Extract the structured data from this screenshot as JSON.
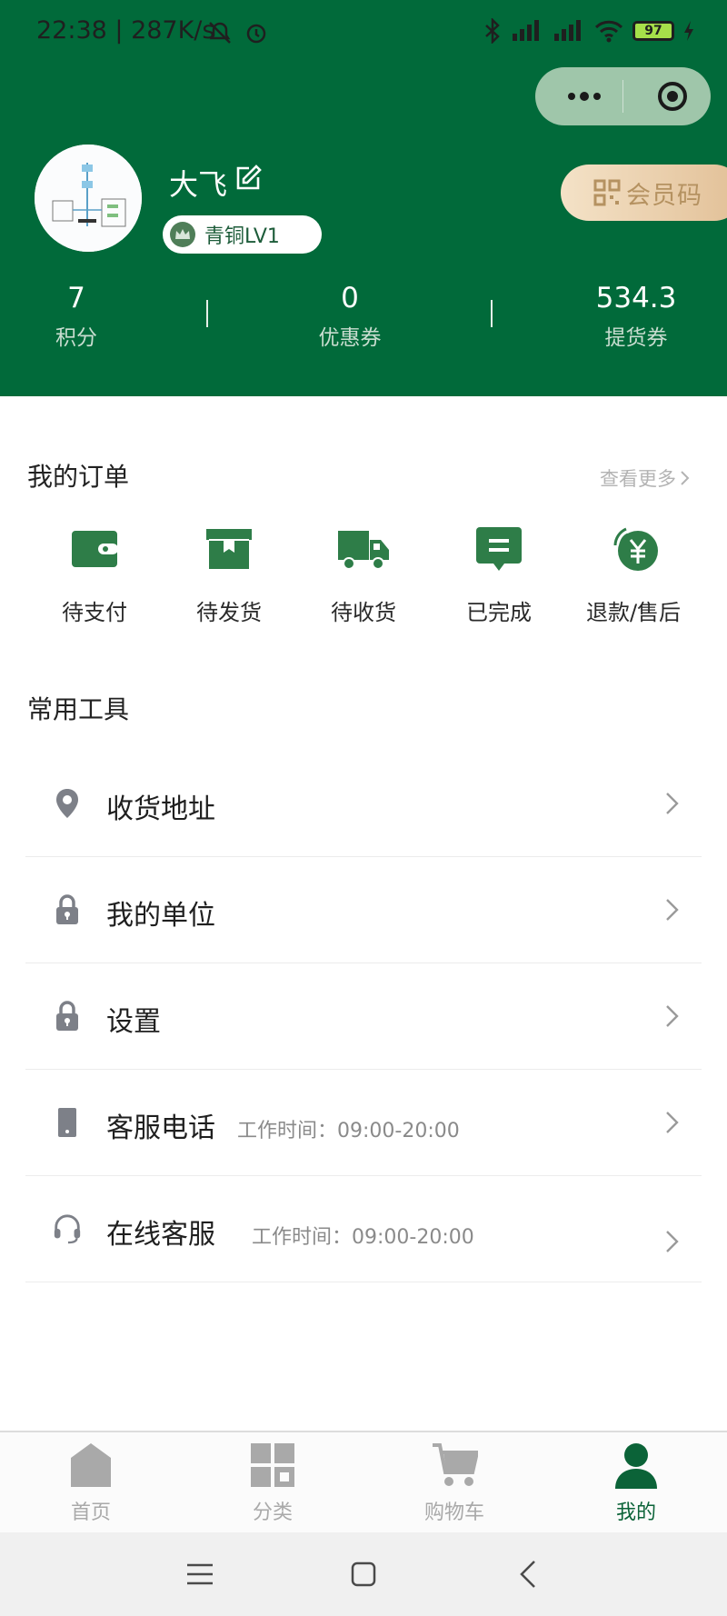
{
  "status_bar": {
    "time_speed": "22:38 | 287K/s",
    "battery": "97"
  },
  "profile": {
    "nickname": "大飞",
    "level": "青铜LV1",
    "member_code_label": "会员码"
  },
  "stats": [
    {
      "value": "7",
      "label": "积分"
    },
    {
      "value": "0",
      "label": "优惠券"
    },
    {
      "value": "534.3",
      "label": "提货券"
    }
  ],
  "orders": {
    "title": "我的订单",
    "see_more": "查看更多",
    "items": [
      {
        "label": "待支付",
        "icon": "wallet-icon"
      },
      {
        "label": "待发货",
        "icon": "box-icon"
      },
      {
        "label": "待收货",
        "icon": "truck-icon"
      },
      {
        "label": "已完成",
        "icon": "message-check-icon"
      },
      {
        "label": "退款/售后",
        "icon": "refund-yuan-icon"
      }
    ]
  },
  "tools": {
    "title": "常用工具",
    "items": [
      {
        "label": "收货地址",
        "icon": "location-pin-icon",
        "sub": ""
      },
      {
        "label": "我的单位",
        "icon": "lock-icon",
        "sub": ""
      },
      {
        "label": "设置",
        "icon": "lock-icon",
        "sub": ""
      },
      {
        "label": "客服电话",
        "icon": "phone-icon",
        "sub": "工作时间：09:00-20:00"
      },
      {
        "label": "在线客服",
        "icon": "headset-icon",
        "sub": "工作时间：09:00-20:00"
      }
    ]
  },
  "tabbar": [
    {
      "label": "首页",
      "icon": "home-icon",
      "active": false
    },
    {
      "label": "分类",
      "icon": "grid-icon",
      "active": false
    },
    {
      "label": "购物车",
      "icon": "cart-icon",
      "active": false
    },
    {
      "label": "我的",
      "icon": "user-icon",
      "active": true
    }
  ],
  "colors": {
    "brand_green": "#016a3a",
    "gold": "#b59261",
    "muted_gray": "#a9a9a9"
  }
}
